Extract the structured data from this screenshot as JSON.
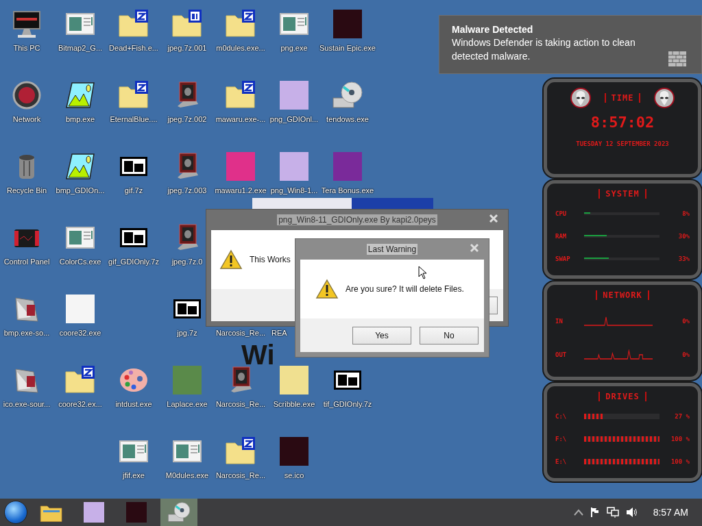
{
  "desktop": {
    "icon_columns": [
      [
        {
          "kind": "computer",
          "label": "This PC"
        },
        {
          "kind": "globe",
          "label": "Network"
        },
        {
          "kind": "bin",
          "label": "Recycle Bin"
        },
        {
          "kind": "panel",
          "label": "Control Panel"
        },
        {
          "kind": "installer",
          "label": "bmp.exe-so..."
        },
        {
          "kind": "installer",
          "label": "ico.exe-sour..."
        }
      ],
      [
        {
          "kind": "window-doc",
          "label": "Bitmap2_G..."
        },
        {
          "kind": "picture",
          "label": "bmp.exe"
        },
        {
          "kind": "picture",
          "label": "bmp_GDIOn..."
        },
        {
          "kind": "window-doc",
          "label": "ColorCs.exe"
        },
        {
          "kind": "photo-anime-white",
          "label": "coore32.exe"
        },
        {
          "kind": "zip-folder",
          "label": "coore32.ex..."
        }
      ],
      [
        {
          "kind": "zip-folder",
          "label": "Dead+Fish.e..."
        },
        {
          "kind": "zip-folder",
          "label": "EternalBlue...."
        },
        {
          "kind": "archive",
          "label": "gif.7z"
        },
        {
          "kind": "archive",
          "label": "gif_GDIOnly.7z"
        },
        {
          "kind": "gap"
        },
        {
          "kind": "palette",
          "label": "intdust.exe"
        },
        {
          "kind": "window-doc",
          "label": "jfif.exe"
        }
      ],
      [
        {
          "kind": "numbered-folder",
          "label": "jpeg.7z.001"
        },
        {
          "kind": "alien",
          "label": "jpeg.7z.002"
        },
        {
          "kind": "alien",
          "label": "jpeg.7z.003"
        },
        {
          "kind": "alien",
          "label": "jpeg.7z.0"
        },
        {
          "kind": "archive",
          "label": "jpg.7z"
        },
        {
          "kind": "photo-stripes",
          "label": "Laplace.exe"
        },
        {
          "kind": "window-doc",
          "label": "M0dules.exe"
        }
      ],
      [
        {
          "kind": "zip-folder",
          "label": "m0dules.exe..."
        },
        {
          "kind": "zip-folder",
          "label": "mawaru.exe-..."
        },
        {
          "kind": "photo-pink",
          "label": "mawaru1.2.exe"
        },
        {
          "kind": "gap"
        },
        {
          "kind": "hidden",
          "label": "Narcosis_Re..."
        },
        {
          "kind": "alien",
          "label": "Narcosis_Re..."
        },
        {
          "kind": "zip-folder",
          "label": "Narcosis_Re..."
        }
      ],
      [
        {
          "kind": "window-doc",
          "label": "png.exe"
        },
        {
          "kind": "photo-anime",
          "label": "png_GDIOnl..."
        },
        {
          "kind": "photo-anime",
          "label": "png_Win8-1..."
        },
        {
          "kind": "gap"
        },
        {
          "kind": "hidden-cut",
          "label": "REA"
        },
        {
          "kind": "photo-yellow",
          "label": "Scribble.exe"
        },
        {
          "kind": "photo-dark",
          "label": "se.ico"
        }
      ],
      [
        {
          "kind": "photo-dark",
          "label": "Sustain Epic.exe"
        },
        {
          "kind": "cd",
          "label": "tendows.exe"
        },
        {
          "kind": "photo-purple",
          "label": "Tera Bonus.exe"
        },
        {
          "kind": "gap"
        },
        {
          "kind": "gap"
        },
        {
          "kind": "archive",
          "label": "tif_GDIOnly.7z"
        }
      ]
    ],
    "background_text": "Wi"
  },
  "dialogs": [
    {
      "title": "png_Win8-11_GDIOnly.exe By kapi2.0peys",
      "message": "This Works"
    },
    {
      "title": "Last Warning",
      "message": "Are you sure? It will delete Files.",
      "buttons": [
        "Yes",
        "No"
      ]
    }
  ],
  "notification": {
    "title": "Malware Detected",
    "body": "Windows Defender is taking action to clean detected malware."
  },
  "gadget": {
    "time": {
      "title": "TIME",
      "clock": "8:57:02",
      "date": "TUESDAY 12 SEPTEMBER 2023"
    },
    "system": {
      "title": "SYSTEM",
      "meters": [
        {
          "label": "CPU",
          "reading": "8%",
          "level": 0.08
        },
        {
          "label": "RAM",
          "reading": "30%",
          "level": 0.3
        },
        {
          "label": "SWAP",
          "reading": "33%",
          "level": 0.33
        }
      ]
    },
    "network": {
      "title": "NETWORK",
      "rows": [
        {
          "label": "IN",
          "reading": "0%"
        },
        {
          "label": "OUT",
          "reading": "0%"
        }
      ]
    },
    "drives": {
      "title": "DRIVES",
      "drives": [
        {
          "label": "C:\\",
          "reading": "27 %",
          "level": 0.27
        },
        {
          "label": "F:\\",
          "reading": "100 %",
          "level": 1
        },
        {
          "label": "E:\\",
          "reading": "100 %",
          "level": 1
        }
      ]
    }
  },
  "taskbar": {
    "apps": [
      {
        "kind": "folder",
        "selected": false
      },
      {
        "kind": "photo-anime",
        "selected": false
      },
      {
        "kind": "photo-dark",
        "selected": false
      },
      {
        "kind": "cd",
        "selected": true
      }
    ],
    "clock": "8:57 AM"
  }
}
